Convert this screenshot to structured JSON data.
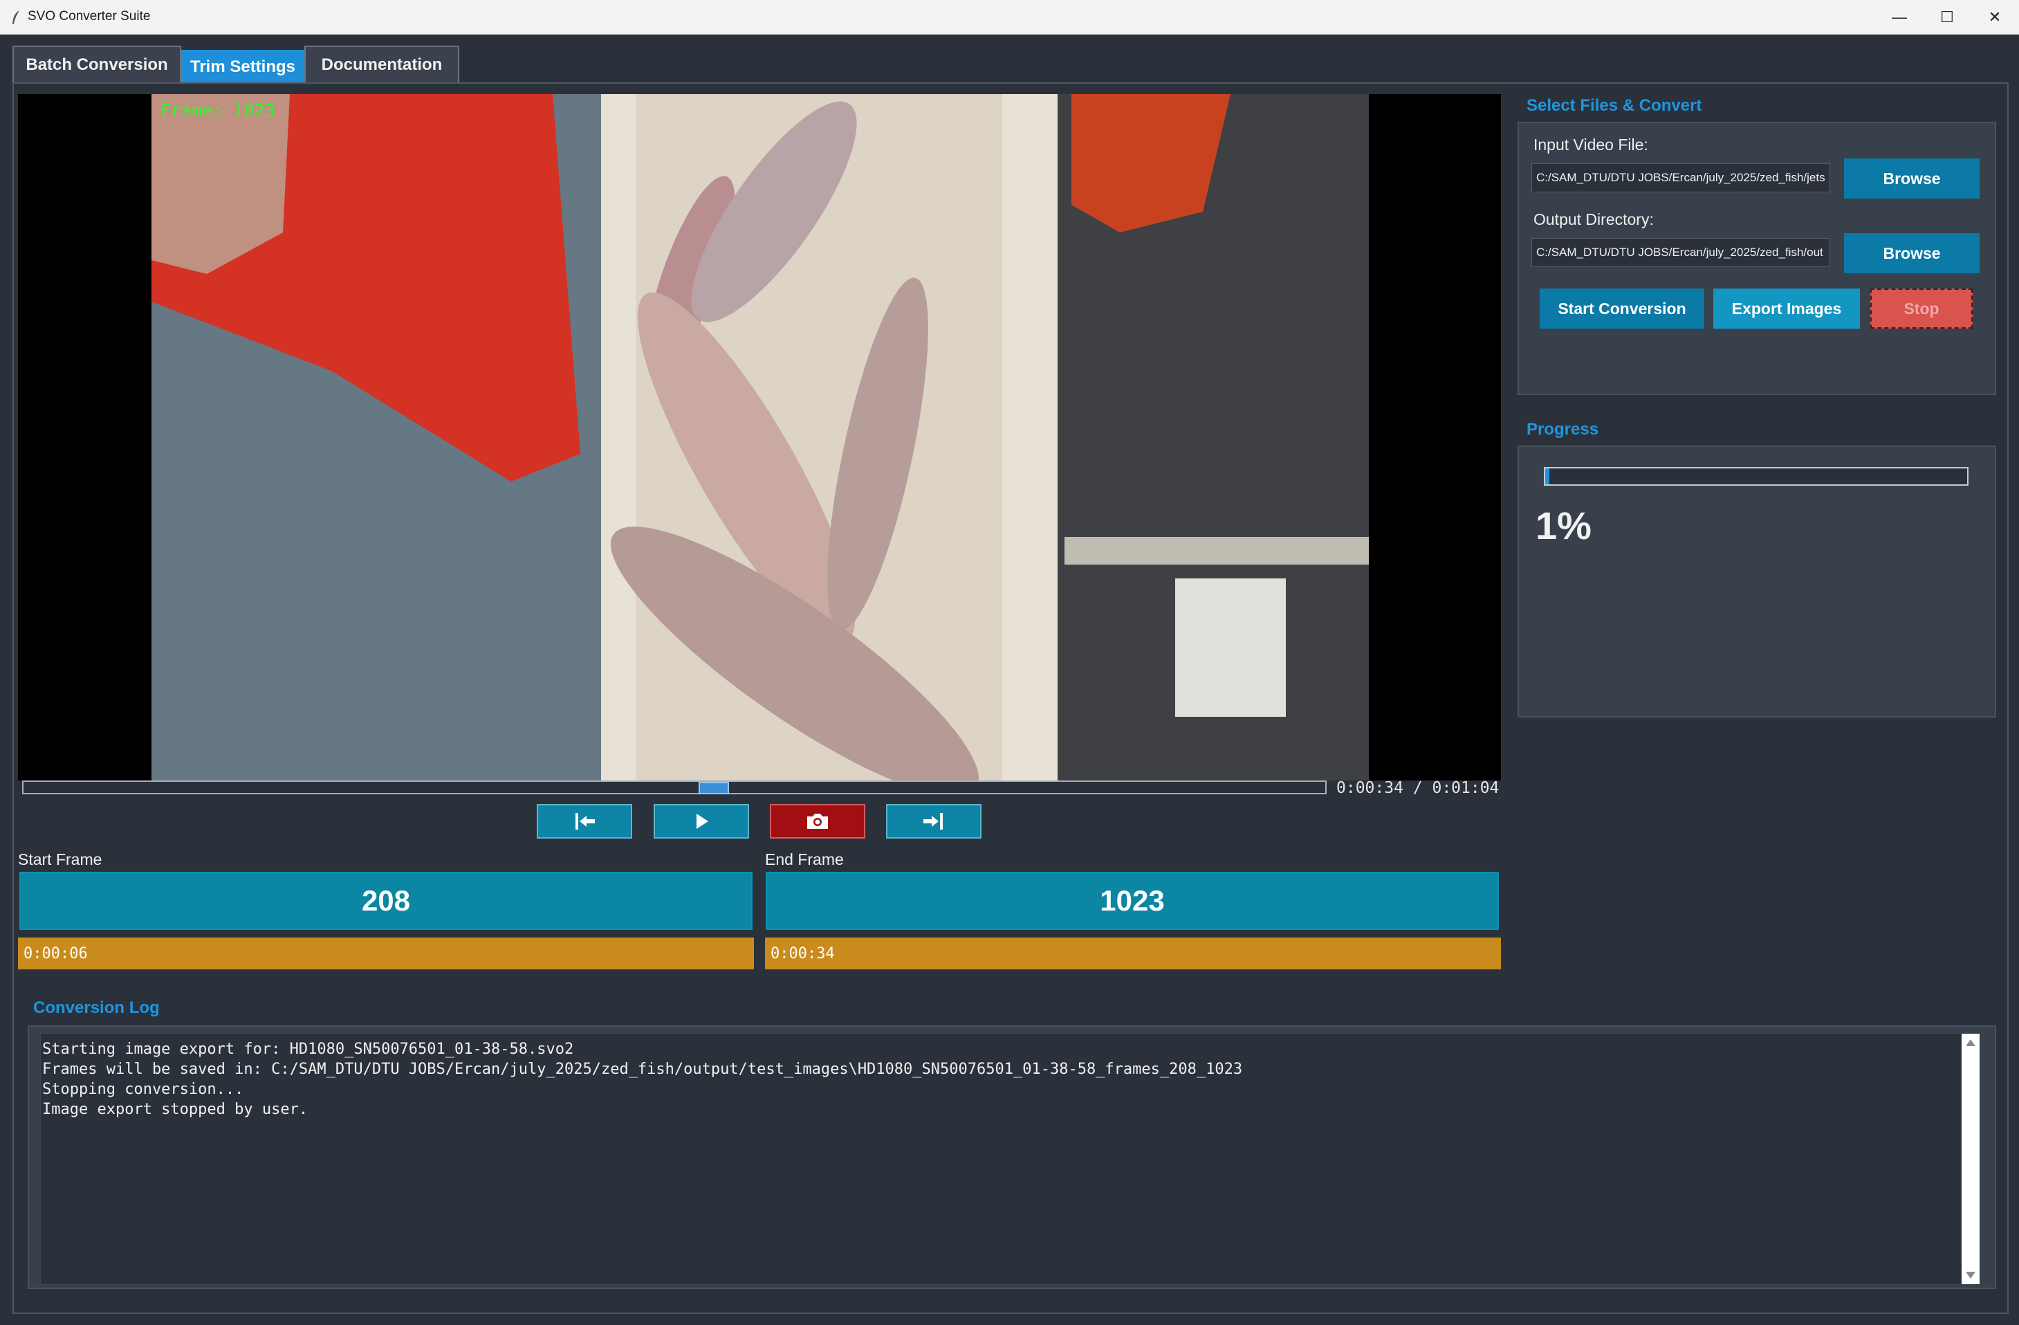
{
  "window": {
    "title": "SVO Converter Suite",
    "minimize": "—",
    "maximize": "☐",
    "close": "✕"
  },
  "tabs": [
    {
      "label": "Batch Conversion",
      "active": false
    },
    {
      "label": "Trim Settings",
      "active": true
    },
    {
      "label": "Documentation",
      "active": false
    }
  ],
  "preview": {
    "frame_label": "Frame: 1023",
    "timecode": "0:00:34 / 0:01:04",
    "seek_position": 0.53
  },
  "transport": {
    "icons": [
      "set-start-icon",
      "play-icon",
      "camera-icon",
      "set-end-icon"
    ]
  },
  "trim": {
    "start_label": "Start Frame",
    "start_frame": "208",
    "start_time": "0:00:06",
    "end_label": "End Frame",
    "end_frame": "1023",
    "end_time": "0:00:34"
  },
  "files": {
    "section_title": "Select Files & Convert",
    "input_label": "Input Video File:",
    "input_value": "C:/SAM_DTU/DTU JOBS/Ercan/july_2025/zed_fish/jets",
    "output_label": "Output Directory:",
    "output_value": "C:/SAM_DTU/DTU JOBS/Ercan/july_2025/zed_fish/out",
    "browse_label": "Browse",
    "start_conversion": "Start Conversion",
    "export_images": "Export Images",
    "stop": "Stop"
  },
  "progress": {
    "section_title": "Progress",
    "percent_text": "1%",
    "value": 0.01
  },
  "log": {
    "section_title": "Conversion Log",
    "lines": [
      "Starting image export for: HD1080_SN50076501_01-38-58.svo2",
      "Frames will be saved in: C:/SAM_DTU/DTU JOBS/Ercan/july_2025/zed_fish/output/test_images\\HD1080_SN50076501_01-38-58_frames_208_1023",
      "Stopping conversion...",
      "Image export stopped by user."
    ]
  },
  "colors": {
    "accent": "#1f95e0",
    "frame_box": "#0b86a3",
    "time_box": "#c98b1d",
    "stop_button": "#d9534f",
    "capture_button": "#a10f12",
    "background": "#2b313b"
  }
}
